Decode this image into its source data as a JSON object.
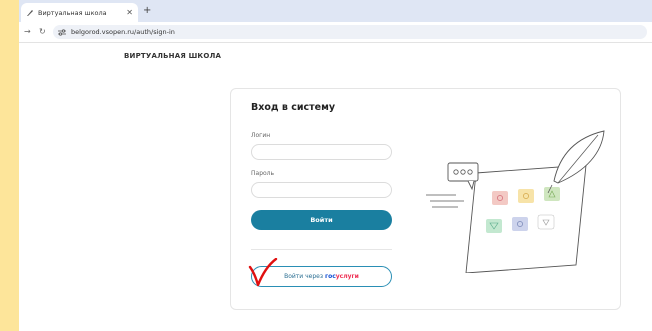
{
  "browser": {
    "tab_title": "Виртуальная школа",
    "new_tab": "+",
    "close_tab": "✕",
    "url": "belgorod.vsopen.ru/auth/sign-in"
  },
  "site": {
    "brand": "ВИРТУАЛЬНАЯ ШКОЛА"
  },
  "login_form": {
    "title": "Вход в систему",
    "login_label": "Логин",
    "login_value": "",
    "password_label": "Пароль",
    "password_value": "",
    "submit_label": "Войти",
    "gosuslugi_prefix": "Войти через ",
    "gosuslugi_part1": "гос",
    "gosuslugi_part2": "услуги"
  },
  "colors": {
    "accent": "#1a7fa0",
    "gosuslugi_blue": "#0d4cd3",
    "gosuslugi_red": "#ee2f53",
    "annotation": "#e01010",
    "background": "#fde59a"
  }
}
